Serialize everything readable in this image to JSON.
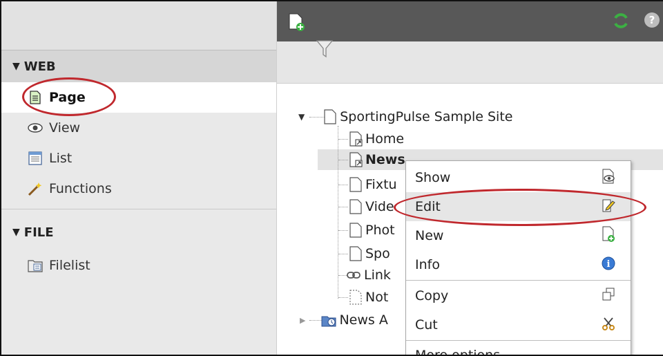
{
  "sidebar": {
    "groups": [
      {
        "label": "WEB",
        "items": [
          {
            "label": "Page",
            "icon": "page-icon",
            "active": true
          },
          {
            "label": "View",
            "icon": "eye-icon"
          },
          {
            "label": "List",
            "icon": "list-icon"
          },
          {
            "label": "Functions",
            "icon": "wand-icon"
          }
        ]
      },
      {
        "label": "FILE",
        "items": [
          {
            "label": "Filelist",
            "icon": "filelist-icon"
          }
        ]
      }
    ]
  },
  "toolbar": {
    "icons": [
      "new-page-icon",
      "filter-icon",
      "refresh-icon",
      "help-icon"
    ]
  },
  "tree": {
    "root": "SportingPulse Sample Site",
    "children": [
      "Home",
      "News",
      "Fixtu",
      "Vide",
      "Phot",
      "Spo",
      "Link",
      "Not"
    ],
    "other_root": "News A"
  },
  "context_menu": {
    "items": [
      {
        "label": "Show",
        "icon": "show-icon"
      },
      {
        "label": "Edit",
        "icon": "edit-icon"
      },
      {
        "label": "New",
        "icon": "new-icon"
      },
      {
        "label": "Info",
        "icon": "info-icon"
      },
      {
        "label": "Copy",
        "icon": "copy-icon"
      },
      {
        "label": "Cut",
        "icon": "scissors-icon"
      },
      {
        "label": "More options..."
      }
    ]
  },
  "colors": {
    "highlight": "#c0282d",
    "toolbar": "#585858",
    "refresh": "#3cb043"
  }
}
